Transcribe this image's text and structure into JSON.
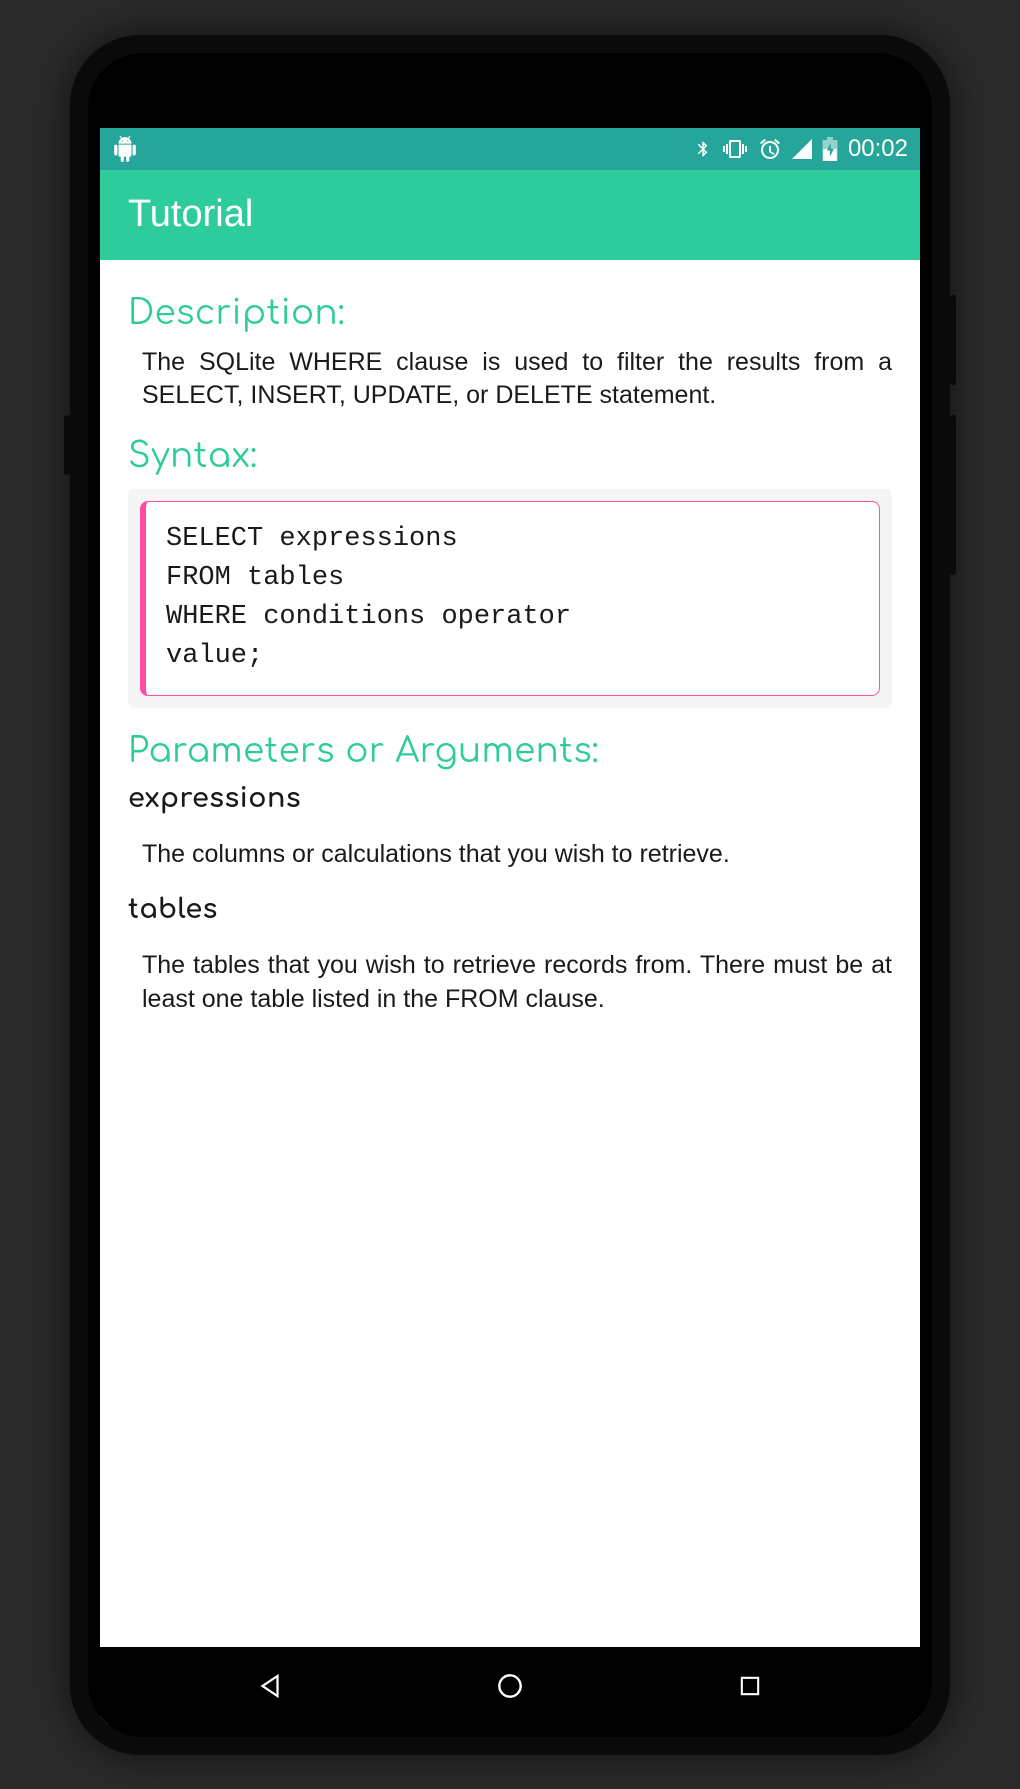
{
  "status_bar": {
    "time": "00:02"
  },
  "app_bar": {
    "title": "Tutorial"
  },
  "content": {
    "description_heading": "Description:",
    "description_text": "The SQLite WHERE clause is used to filter the results from a SELECT, INSERT, UPDATE, or DELETE statement.",
    "syntax_heading": "Syntax:",
    "syntax_code": "SELECT expressions\nFROM tables\nWHERE conditions operator\nvalue;",
    "parameters_heading": "Parameters or Arguments:",
    "params": [
      {
        "name": "expressions",
        "desc": "The columns or calculations that you wish to retrieve."
      },
      {
        "name": "tables",
        "desc": "The tables that you wish to retrieve records from. There must be at least one table listed in the FROM clause."
      }
    ]
  }
}
